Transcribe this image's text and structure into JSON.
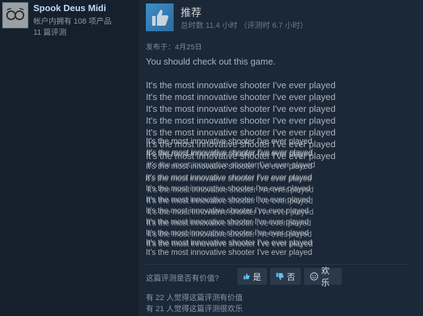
{
  "user": {
    "name": "Spook Deus Midi",
    "products_owned": "帐户内拥有 108 项产品",
    "review_count": "11 篇评测"
  },
  "review": {
    "verdict": "推荐",
    "hours": "总时数 11.4 小时 （评测时 6.7 小时）",
    "posted": "发布于：4月25日",
    "intro": "You should check out this game.",
    "lines": [
      "It's the most innovative shooter I've ever played",
      "It's the most innovative shooter I've ever played",
      "It's the most innovative shooter I've ever played",
      "It's the most innovative shooter I've ever played",
      "It's the most innovative shooter I've ever played",
      "It's the most innovative shooter I've ever played",
      "It's the most innovative shooter I've ever played"
    ]
  },
  "feedback": {
    "question": "这篇评测是否有价值?",
    "yes_label": "是",
    "no_label": "否",
    "funny_label": "欢乐",
    "helpful_count": "有 22 人觉得这篇评测有价值",
    "funny_count": "有 21 人觉得这篇评测很欢乐"
  },
  "icons": {
    "thumb": "thumbs-up-icon",
    "yes": "thumbs-up-icon",
    "no": "thumbs-down-icon",
    "funny": "smiley-icon"
  },
  "colors": {
    "background": "#1b2838",
    "accent": "#3d8ec9",
    "username": "#c1dbf4"
  }
}
